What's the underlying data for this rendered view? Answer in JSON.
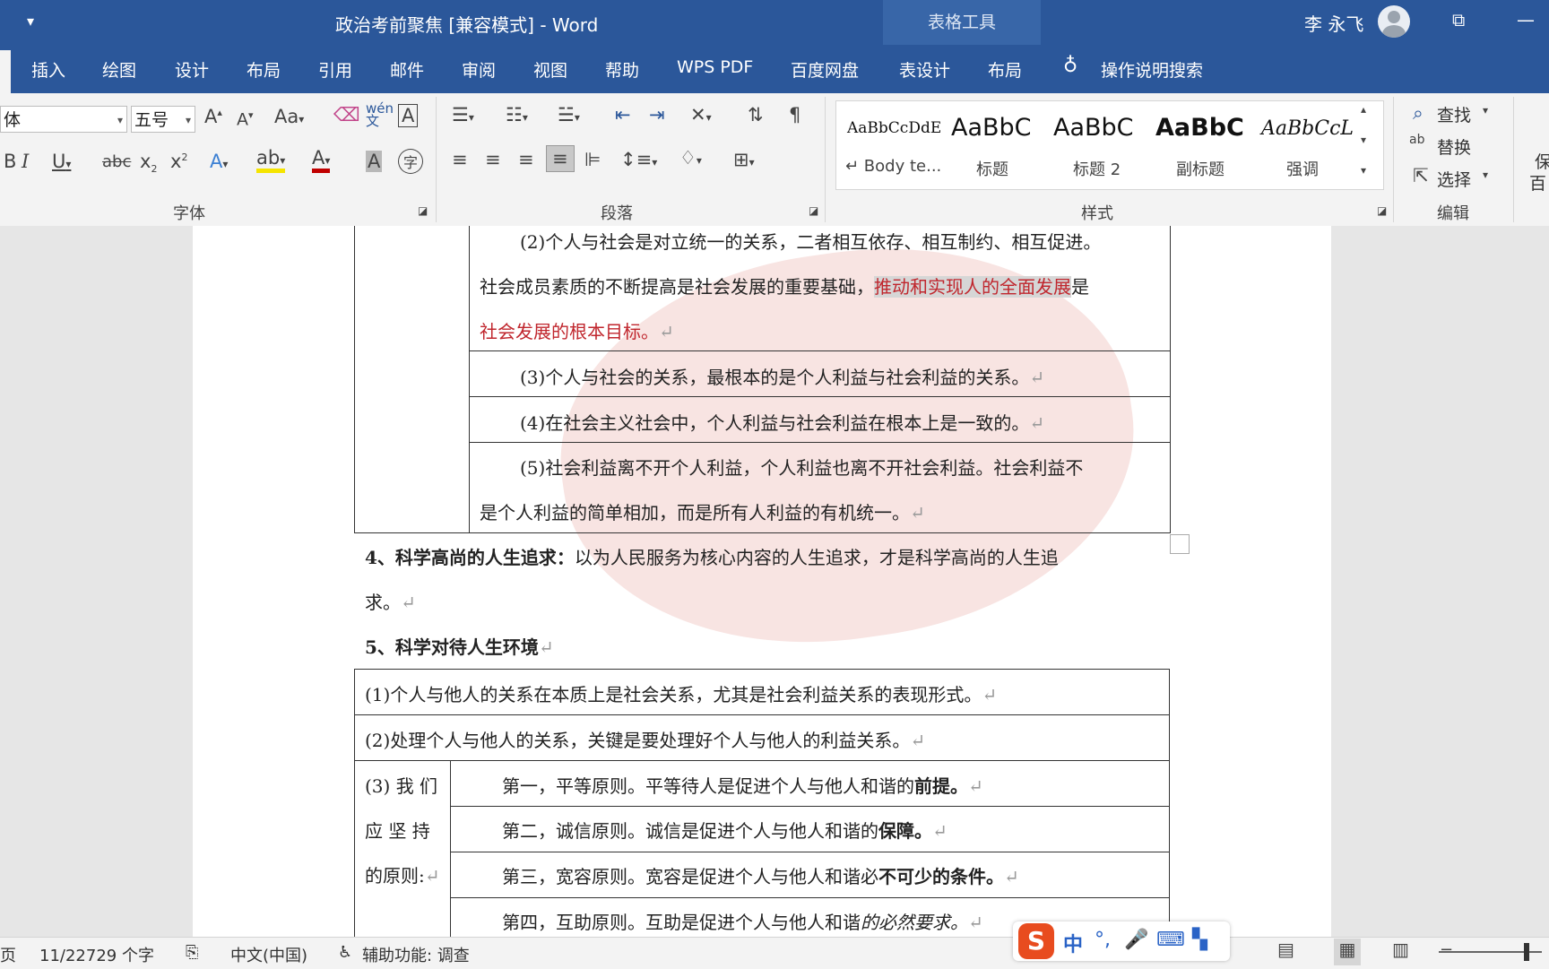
{
  "titlebar": {
    "title": "政治考前聚焦 [兼容模式]  -  Word",
    "context_tab": "表格工具",
    "user": "李 永飞",
    "restore_glyph": "⧉",
    "minimize_glyph": "—"
  },
  "menu": {
    "tabs": [
      "插入",
      "绘图",
      "设计",
      "布局",
      "引用",
      "邮件",
      "审阅",
      "视图",
      "帮助",
      "WPS PDF",
      "百度网盘",
      "表设计",
      "布局"
    ],
    "tell_me": "操作说明搜索"
  },
  "ribbon": {
    "font_name": "体",
    "font_size": "五号",
    "group_font": "字体",
    "group_paragraph": "段落",
    "group_styles": "样式",
    "group_editing": "编辑",
    "styles": [
      {
        "preview": "AaBbCcDdE",
        "name": "↵ Body te..."
      },
      {
        "preview": "AaBbC",
        "name": "标题"
      },
      {
        "preview": "AaBbC",
        "name": "标题 2"
      },
      {
        "preview": "AaBbC",
        "name": "副标题"
      },
      {
        "preview": "AaBbCcL",
        "name": "强调"
      }
    ],
    "find": "查找",
    "replace": "替换",
    "select": "选择",
    "right_clip_1": "保",
    "right_clip_2": "百"
  },
  "document": {
    "t1_row1_a": "(2)个人与社会是对立统一的关系，二者相互依存、相互制约、相互促进。",
    "t1_row1_b_pre": "社会成员素质的不断提高是社会发展的重要基础，",
    "t1_row1_b_hl": "推动和实现人的全面发展",
    "t1_row1_b_post": "是",
    "t1_row1_c": "社会发展的根本目标。",
    "t1_row2": "(3)个人与社会的关系，最根本的是个人利益与社会利益的关系。",
    "t1_row3": "(4)在社会主义社会中，个人利益与社会利益在根本上是一致的。",
    "t1_row4_a": "(5)社会利益离不开个人利益，个人利益也离不开社会利益。社会利益不",
    "t1_row4_b": "是个人利益的简单相加，而是所有人利益的有机统一。",
    "h4_bold": "4、科学高尚的人生追求：",
    "h4_rest": "以为人民服务为核心内容的人生追求，才是科学高尚的人生追",
    "h4_cont": "求。",
    "h5": "5、科学对待人生环境",
    "t2_row1": "(1)个人与他人的关系在本质上是社会关系，尤其是社会利益关系的表现形式。",
    "t2_row2": "(2)处理个人与他人的关系，关键是要处理好个人与他人的利益关系。",
    "t2_left_1": "(3) 我 们",
    "t2_left_2": "应 坚 持",
    "t2_left_3": "的原则:",
    "p1_pre": "第一，平等原则。平等待人是促进个人与他人和谐的",
    "p1_b": "前提。",
    "p2_pre": "第二，诚信原则。诚信是促进个人与他人和谐的",
    "p2_b": "保障。",
    "p3_pre": "第三，宽容原则。宽容是促进个人与他人和谐必",
    "p3_b": "不可少的条件。",
    "p4_pre": "第四，互助原则。互助是促进个人与他人和谐",
    "p4_i": "的必然要求。",
    "para_mark": "↵"
  },
  "status": {
    "page": "页",
    "words": "11/22729 个字",
    "language": "中文(中国)",
    "accessibility": "辅助功能: 调查"
  },
  "ime": {
    "logo": "S",
    "mode": "中",
    "punct": "°,"
  }
}
